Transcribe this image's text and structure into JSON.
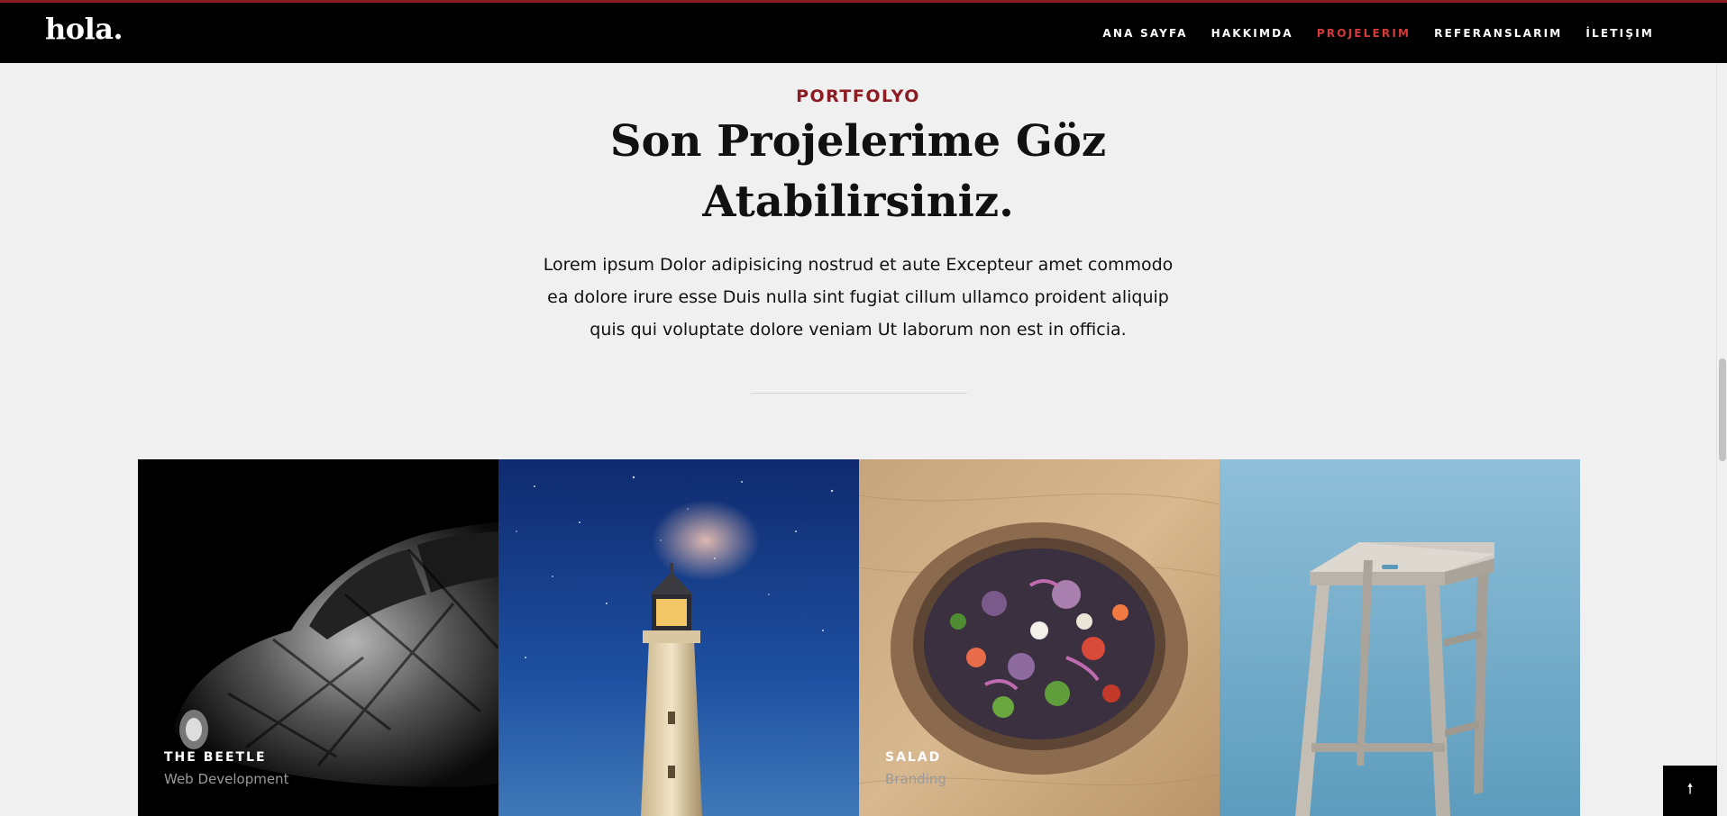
{
  "header": {
    "logo": "hola.",
    "nav": [
      {
        "label": "ANA SAYFA",
        "active": false
      },
      {
        "label": "HAKKIMDA",
        "active": false
      },
      {
        "label": "PROJELERIM",
        "active": true
      },
      {
        "label": "REFERANSLARIM",
        "active": false
      },
      {
        "label": "İLETIŞIM",
        "active": false
      }
    ]
  },
  "section": {
    "eyebrow": "PORTFOLYO",
    "title_line1": "Son Projelerime Göz",
    "title_line2": "Atabilirsiniz.",
    "description_lines": [
      "Lorem ipsum Dolor adipisicing nostrud et aute Excepteur amet commodo",
      "ea dolore irure esse Duis nulla sint fugiat cillum ullamco proident aliquip",
      "quis qui voluptate dolore veniam Ut laborum non est in officia."
    ]
  },
  "portfolio": [
    {
      "title": "THE BEETLE",
      "category": "Web Development",
      "image": "black-and-white car photo"
    },
    {
      "title": "",
      "category": "",
      "image": "lighthouse under starry sky photo"
    },
    {
      "title": "SALAD",
      "category": "Branding",
      "image": "salad bowl on wooden table photo"
    },
    {
      "title": "",
      "category": "",
      "image": "wooden stool on blue background photo"
    }
  ],
  "back_to_top": {
    "icon": "arrow-up-icon",
    "glyph": "🠕"
  },
  "colors": {
    "accent": "#8c1c24",
    "nav_active": "#d63a3a",
    "header_bg": "#000000",
    "page_bg": "#f0f0f0"
  }
}
